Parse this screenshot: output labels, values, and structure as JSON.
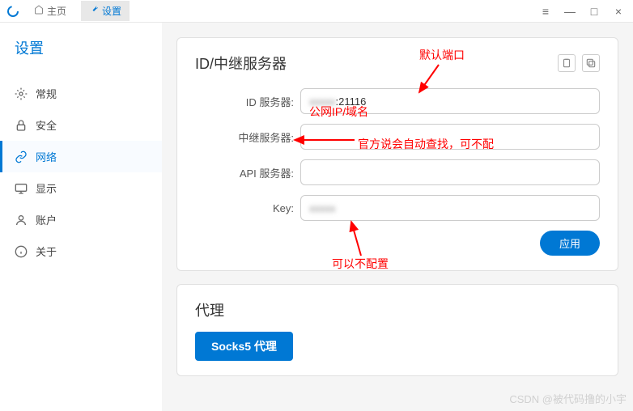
{
  "titlebar": {
    "home_tab": "主页",
    "settings_tab": "设置"
  },
  "sidebar": {
    "title": "设置",
    "items": [
      {
        "label": "常规"
      },
      {
        "label": "安全"
      },
      {
        "label": "网络"
      },
      {
        "label": "显示"
      },
      {
        "label": "账户"
      },
      {
        "label": "关于"
      }
    ]
  },
  "server_card": {
    "title": "ID/中继服务器",
    "rows": {
      "id_server": {
        "label": "ID 服务器:",
        "value": ":21116",
        "blur_prefix": "xxxxx"
      },
      "relay_server": {
        "label": "中继服务器:",
        "value": ""
      },
      "api_server": {
        "label": "API 服务器:",
        "value": ""
      },
      "key": {
        "label": "Key:",
        "value": "",
        "blur_prefix": "xxxxx"
      }
    },
    "apply": "应用"
  },
  "proxy_card": {
    "title": "代理",
    "socks_btn": "Socks5 代理"
  },
  "annotations": {
    "default_port": "默认端口",
    "public_ip": "公网IP/域名",
    "auto_find": "官方说会自动查找，可不配",
    "optional": "可以不配置"
  },
  "watermark": "CSDN @被代码撸的小宇"
}
